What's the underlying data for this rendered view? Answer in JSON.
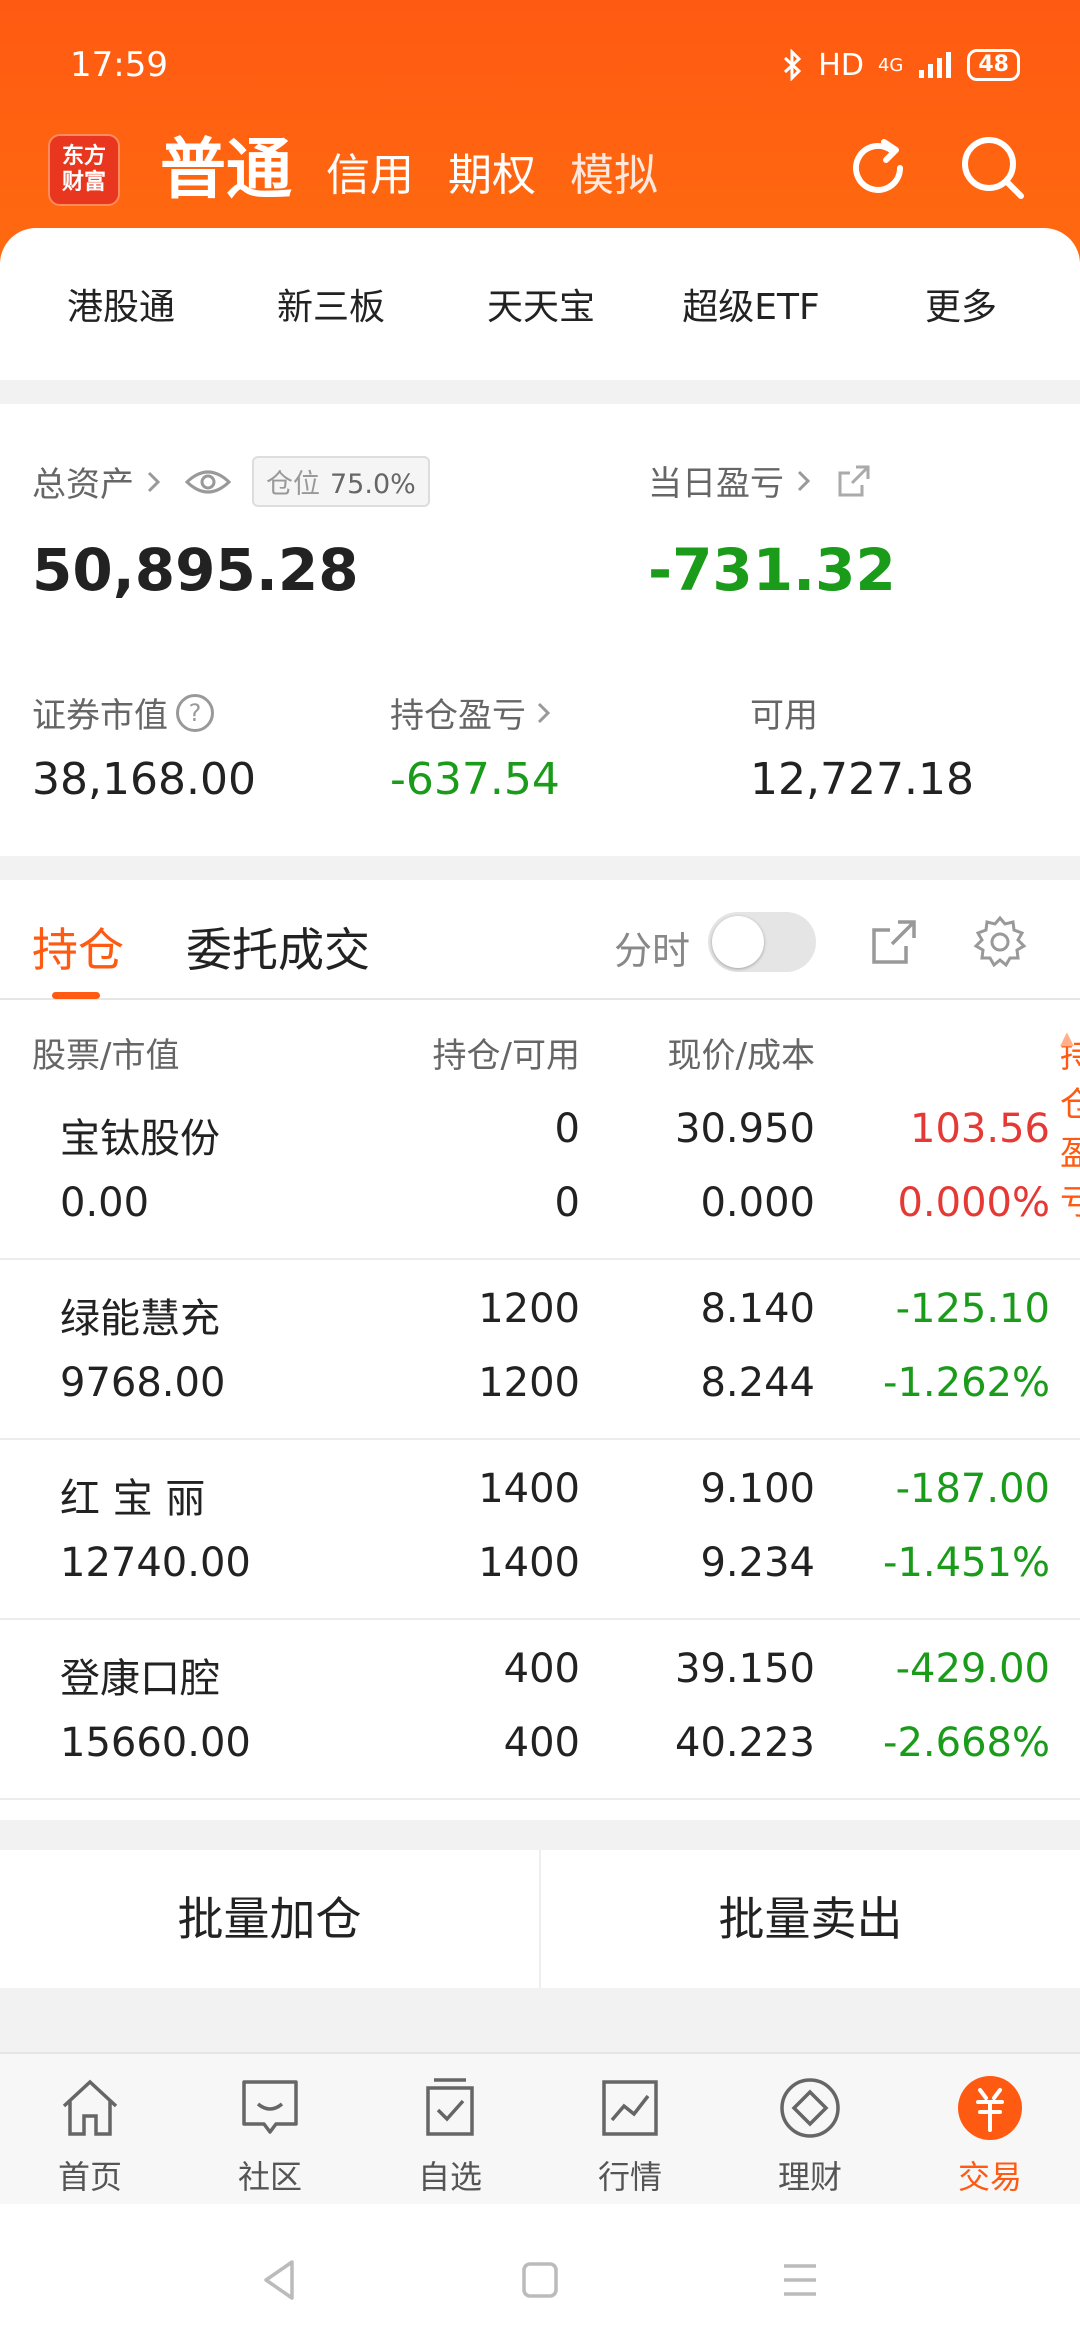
{
  "status_bar": {
    "time": "17:59",
    "signal": "HD",
    "network": "4G",
    "battery": "48"
  },
  "header": {
    "logo_text": "东方财富",
    "tabs": [
      "普通",
      "信用",
      "期权",
      "模拟"
    ]
  },
  "quick_links": [
    "港股通",
    "新三板",
    "天天宝",
    "超级ETF",
    "更多"
  ],
  "assets": {
    "total_label": "总资产",
    "position_label": "仓位",
    "position_value": "75.0%",
    "total_value": "50,895.28",
    "day_pnl_label": "当日盈亏",
    "day_pnl_value": "-731.32",
    "market_value_label": "证券市值",
    "market_value": "38,168.00",
    "holding_pnl_label": "持仓盈亏",
    "holding_pnl": "-637.54",
    "available_label": "可用",
    "available": "12,727.18"
  },
  "holdings": {
    "tabs": [
      "持仓",
      "委托成交"
    ],
    "toggle_label": "分时",
    "columns": [
      "股票/市值",
      "持仓/可用",
      "现价/成本",
      "持仓盈亏"
    ],
    "rows": [
      {
        "name": "宝钛股份",
        "mv": "0.00",
        "pos": "0",
        "avail": "0",
        "price": "30.950",
        "cost": "0.000",
        "pnl": "103.56",
        "pct": "0.000%",
        "color": "#e53935"
      },
      {
        "name": "绿能慧充",
        "mv": "9768.00",
        "pos": "1200",
        "avail": "1200",
        "price": "8.140",
        "cost": "8.244",
        "pnl": "-125.10",
        "pct": "-1.262%",
        "color": "#1a9b1a"
      },
      {
        "name": "红 宝 丽",
        "mv": "12740.00",
        "pos": "1400",
        "avail": "1400",
        "price": "9.100",
        "cost": "9.234",
        "pnl": "-187.00",
        "pct": "-1.451%",
        "color": "#1a9b1a"
      },
      {
        "name": "登康口腔",
        "mv": "15660.00",
        "pos": "400",
        "avail": "400",
        "price": "39.150",
        "cost": "40.223",
        "pnl": "-429.00",
        "pct": "-2.668%",
        "color": "#1a9b1a"
      }
    ]
  },
  "actions": [
    "批量加仓",
    "批量卖出"
  ],
  "bottom_nav": [
    "首页",
    "社区",
    "自选",
    "行情",
    "理财",
    "交易"
  ],
  "colors": {
    "brand": "#ff5a12",
    "up": "#e53935",
    "down": "#1a9b1a"
  }
}
